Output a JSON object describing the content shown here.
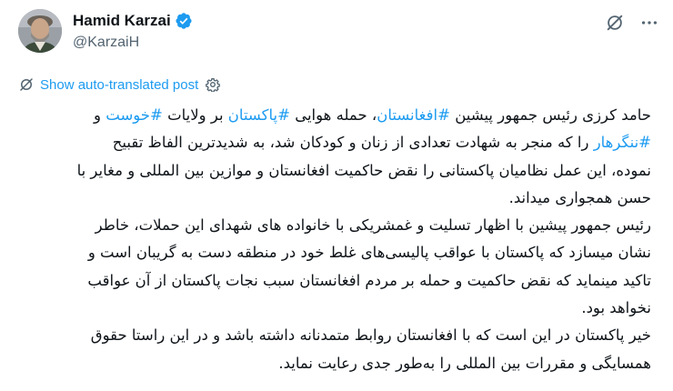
{
  "author": {
    "display_name": "Hamid Karzai",
    "handle": "@KarzaiH",
    "verified": true,
    "avatar_icon": "profile-photo"
  },
  "header_actions": [
    {
      "icon": "grok-icon"
    },
    {
      "icon": "more-icon"
    }
  ],
  "translate": {
    "label": "Show auto-translated post",
    "icon": "translate-icon",
    "settings_icon": "gear-icon"
  },
  "colors": {
    "accent": "#1d9bf0",
    "text": "#0f1419",
    "secondary": "#536471"
  },
  "post": {
    "p1": {
      "t1": "حامد کرزی رئیس جمهور پیشین ",
      "h1": "#افغانستان",
      "t2": "، حمله هوایی ",
      "h2": "#پاکستان",
      "t3": " بر ولایات ",
      "h3": "#خوست",
      "t4": " و ",
      "h4": "#ننگرهار",
      "t5": " را که منجر به شهادت تعدادی از زنان و کودکان شد، به شدیدترین الفاظ تقبیح نموده، این عمل نظامیان پاکستانی را نقض حاکمیت افغانستان و موازین بین المللی و مغایر با حسن همجواری میداند."
    },
    "p2": "رئیس جمهور پیشین با اظهار تسلیت و غمشریکی با خانواده های شهدای این حملات، خاطر نشان میسازد که پاکستان با عواقب پالیسی‌های غلط خود در منطقه دست به گریبان است و تاکید مینماید که نقض حاکمیت و حمله بر مردم افغانستان سبب نجات پاکستان از آن عواقب نخواهد بود.",
    "p3": "خیر پاکستان در این است که با افغانستان روابط متمدنانه داشته باشد و در این راستا حقوق همسایگی و مقررات بین المللی را به‌طور جدی رعایت نماید."
  }
}
